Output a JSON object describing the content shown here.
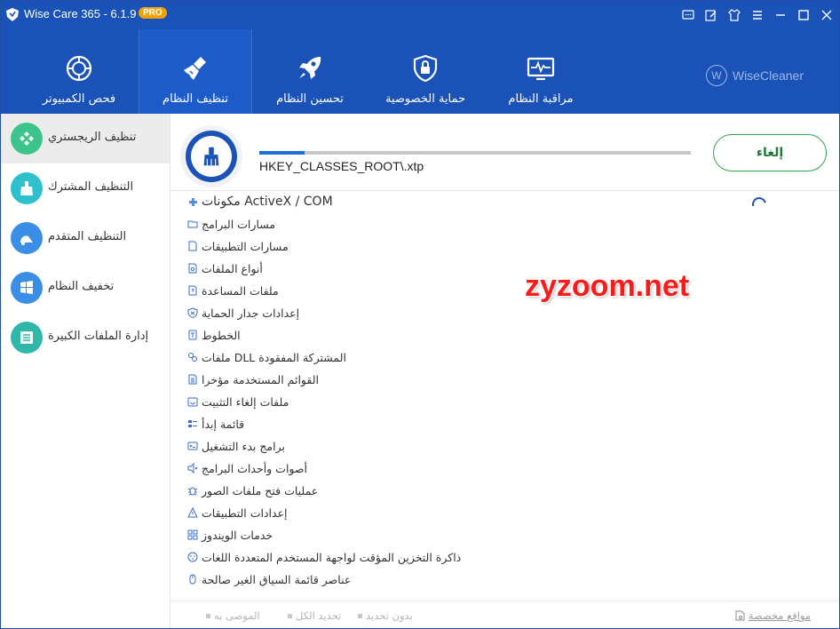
{
  "window": {
    "title": "Wise Care 365 - 6.1.9",
    "badge": "PRO"
  },
  "nav": {
    "items": [
      {
        "label": "فحص الكمبيوتر",
        "icon": "target-icon"
      },
      {
        "label": "تنظيف النظام",
        "icon": "broom-icon"
      },
      {
        "label": "تحسين النظام",
        "icon": "rocket-icon"
      },
      {
        "label": "حماية الخصوصية",
        "icon": "shield-lock-icon"
      },
      {
        "label": "مراقبة النظام",
        "icon": "monitor-pulse-icon"
      }
    ],
    "brand": "WiseCleaner"
  },
  "sidebar": {
    "items": [
      {
        "label": "تنظيف الريجستري",
        "color": "#3cc48a"
      },
      {
        "label": "التنظيف المشترك",
        "color": "#2ec0cc"
      },
      {
        "label": "التنظيف المتقدم",
        "color": "#3a8ee6"
      },
      {
        "label": "تخفيف النظام",
        "color": "#3a8ee6"
      },
      {
        "label": "إدارة الملفات الكبيرة",
        "color": "#2fb7a8"
      }
    ]
  },
  "scan": {
    "path": "HKEY_CLASSES_ROOT\\.xtp",
    "progress": 0.105,
    "cancel_label": "إلغاء"
  },
  "categories": [
    {
      "label": "مكونات ActiveX / COM",
      "icon": "puzzle-icon"
    },
    {
      "label": "مسارات البرامج",
      "icon": "folder-icon"
    },
    {
      "label": "مسارات التطبيقات",
      "icon": "document-icon"
    },
    {
      "label": "أنواع الملفات",
      "icon": "file-type-icon"
    },
    {
      "label": "ملفات المساعدة",
      "icon": "help-file-icon"
    },
    {
      "label": "إعدادات جدار الحماية",
      "icon": "shield-icon"
    },
    {
      "label": "الخطوط",
      "icon": "font-icon"
    },
    {
      "label": "ملفات DLL المشتركة المفقودة",
      "icon": "link-icon"
    },
    {
      "label": "القوائم المستخدمة مؤخرا",
      "icon": "recent-list-icon"
    },
    {
      "label": "ملفات إلغاء التثبيت",
      "icon": "uninstall-icon"
    },
    {
      "label": "قائمة إبدأ",
      "icon": "start-menu-icon"
    },
    {
      "label": "برامج بدء التشغيل",
      "icon": "startup-icon"
    },
    {
      "label": "أصوات وأحداث البرامج",
      "icon": "sound-icon"
    },
    {
      "label": "عمليات فتح ملفات الصور",
      "icon": "bug-icon"
    },
    {
      "label": "إعدادات التطبيقات",
      "icon": "warning-icon"
    },
    {
      "label": "خدمات الويندوز",
      "icon": "windows-services-icon"
    },
    {
      "label": "ذاكرة التخزين المؤقت لواجهة المستخدم المتعددة اللغات",
      "icon": "globe-icon"
    },
    {
      "label": "عناصر قائمة السياق الغير صالحة",
      "icon": "mouse-icon"
    }
  ],
  "watermark": "zyzoom.net",
  "footer": {
    "recommended": "الموصى به",
    "select_all": "تحديد الكل",
    "select_none": "بدون تحديد",
    "custom_sites": "مواقع مخصصة"
  },
  "colors": {
    "primary": "#1a52b8",
    "accent": "#2ea44f",
    "badge": "#f2a100"
  }
}
